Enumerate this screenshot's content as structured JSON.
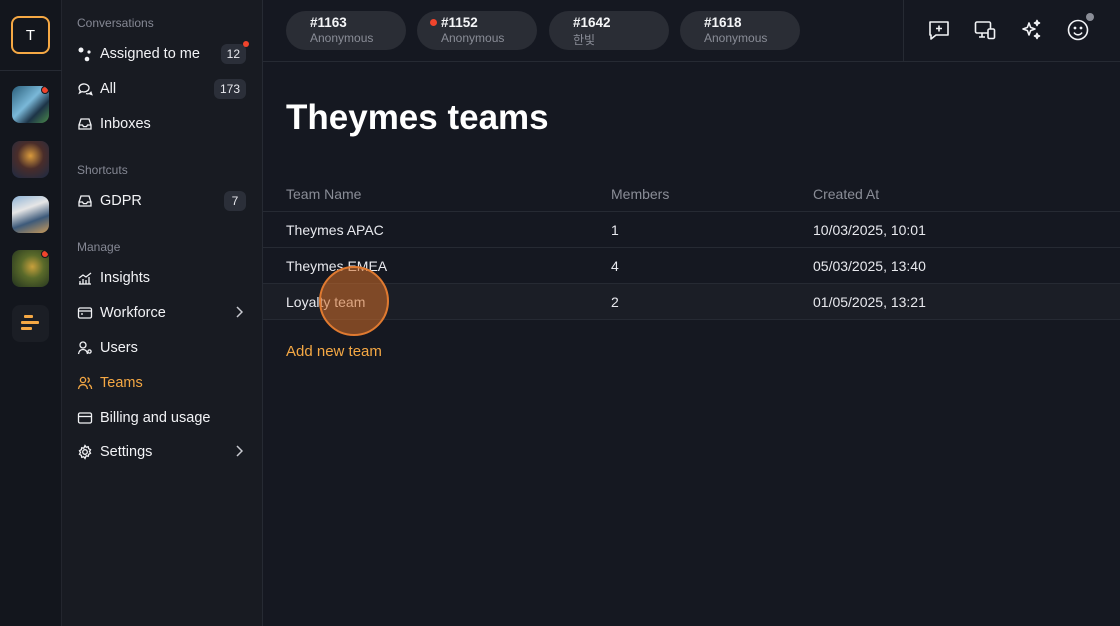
{
  "rail": {
    "workspace_initial": "T"
  },
  "sidebar": {
    "sections": {
      "conversations": "Conversations",
      "shortcuts": "Shortcuts",
      "manage": "Manage"
    },
    "conversations": [
      {
        "label": "Assigned to me",
        "icon": "assigned-icon",
        "badge": "12"
      },
      {
        "label": "All",
        "icon": "chat-bubbles-icon",
        "badge": "173"
      },
      {
        "label": "Inboxes",
        "icon": "inbox-icon"
      }
    ],
    "shortcuts": [
      {
        "label": "GDPR",
        "icon": "inbox-icon",
        "badge": "7"
      }
    ],
    "manage": [
      {
        "label": "Insights",
        "icon": "chart-icon"
      },
      {
        "label": "Workforce",
        "icon": "window-icon"
      },
      {
        "label": "Users",
        "icon": "user-icon"
      },
      {
        "label": "Teams",
        "icon": "team-icon"
      },
      {
        "label": "Billing and usage",
        "icon": "card-icon"
      },
      {
        "label": "Settings",
        "icon": "gear-icon"
      }
    ]
  },
  "topbar": {
    "tabs": [
      {
        "number": "#1163",
        "name": "Anonymous"
      },
      {
        "number": "#1152",
        "name": "Anonymous"
      },
      {
        "number": "#1642",
        "name": "한빛"
      },
      {
        "number": "#1618",
        "name": "Anonymous"
      }
    ],
    "icons": [
      "new-message-icon",
      "devices-icon",
      "sparkles-icon",
      "smiley-icon"
    ]
  },
  "main": {
    "title": "Theymes teams",
    "columns": [
      "Team Name",
      "Members",
      "Created At"
    ],
    "rows": [
      {
        "name": "Theymes APAC",
        "members": "1",
        "created": "10/03/2025, 10:01"
      },
      {
        "name": "Theymes EMEA",
        "members": "4",
        "created": "05/03/2025, 13:40"
      },
      {
        "name": "Loyalty team",
        "members": "2",
        "created": "01/05/2025, 13:21"
      }
    ],
    "add_label": "Add new team"
  },
  "colors": {
    "accent": "#f5a844",
    "notification": "#f0442c",
    "background": "#151821"
  }
}
